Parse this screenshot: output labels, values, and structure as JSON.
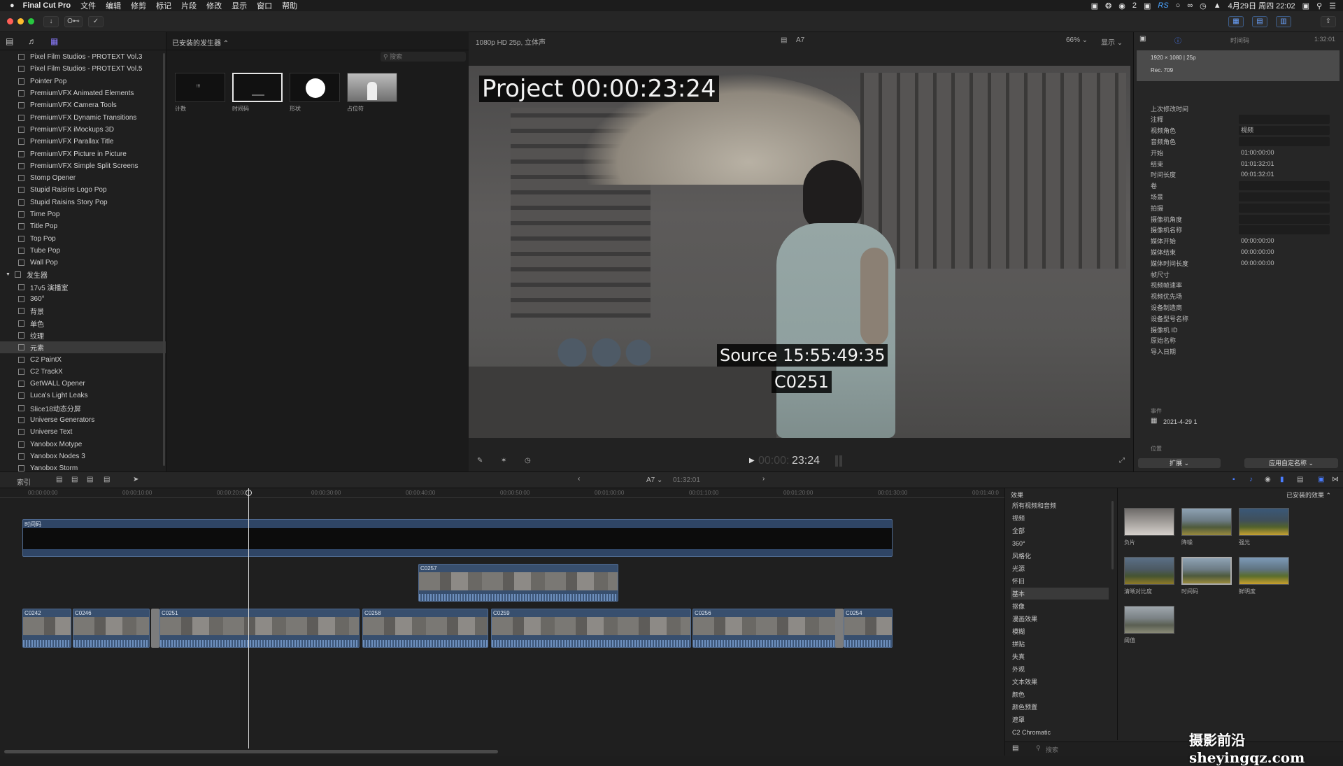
{
  "menubar": {
    "apple": "",
    "app": "Final Cut Pro",
    "items": [
      "文件",
      "编辑",
      "修剪",
      "标记",
      "片段",
      "修改",
      "显示",
      "窗口",
      "帮助"
    ],
    "status_wechat_count": "2",
    "status_letters": "RS",
    "clock": "4月29日 周四 22:02"
  },
  "toolbar": {
    "key_label": "O⊷"
  },
  "sidebar": {
    "items": [
      {
        "label": "Pixel Film Studios - PROTEXT Vol.3",
        "type": "item"
      },
      {
        "label": "Pixel Film Studios - PROTEXT Vol.5",
        "type": "item"
      },
      {
        "label": "Pointer Pop",
        "type": "item"
      },
      {
        "label": "PremiumVFX Animated Elements",
        "type": "item"
      },
      {
        "label": "PremiumVFX Camera Tools",
        "type": "item"
      },
      {
        "label": "PremiumVFX Dynamic Transitions",
        "type": "item"
      },
      {
        "label": "PremiumVFX iMockups 3D",
        "type": "item"
      },
      {
        "label": "PremiumVFX Parallax Title",
        "type": "item"
      },
      {
        "label": "PremiumVFX Picture in Picture",
        "type": "item"
      },
      {
        "label": "PremiumVFX Simple Split Screens",
        "type": "item"
      },
      {
        "label": "Stomp Opener",
        "type": "item"
      },
      {
        "label": "Stupid Raisins Logo Pop",
        "type": "item"
      },
      {
        "label": "Stupid Raisins Story Pop",
        "type": "item"
      },
      {
        "label": "Time Pop",
        "type": "item"
      },
      {
        "label": "Title Pop",
        "type": "item"
      },
      {
        "label": "Top Pop",
        "type": "item"
      },
      {
        "label": "Tube Pop",
        "type": "item"
      },
      {
        "label": "Wall Pop",
        "type": "item"
      },
      {
        "label": "发生器",
        "type": "group"
      },
      {
        "label": "17v5 演播室",
        "type": "item"
      },
      {
        "label": "360°",
        "type": "item"
      },
      {
        "label": "背景",
        "type": "item"
      },
      {
        "label": "单色",
        "type": "item"
      },
      {
        "label": "纹理",
        "type": "item"
      },
      {
        "label": "元素",
        "type": "selected"
      },
      {
        "label": "C2 PaintX",
        "type": "item"
      },
      {
        "label": "C2 TrackX",
        "type": "item"
      },
      {
        "label": "GetWALL Opener",
        "type": "item"
      },
      {
        "label": "Luca's Light Leaks",
        "type": "item"
      },
      {
        "label": "Slice18动态分屏",
        "type": "item"
      },
      {
        "label": "Universe Generators",
        "type": "item"
      },
      {
        "label": "Universe Text",
        "type": "item"
      },
      {
        "label": "Yanobox Motype",
        "type": "item"
      },
      {
        "label": "Yanobox Nodes 3",
        "type": "item"
      },
      {
        "label": "Yanobox Storm",
        "type": "item"
      }
    ]
  },
  "browser": {
    "title": "已安装的发生器 ⌃",
    "search_placeholder": "搜索",
    "thumbs": [
      {
        "label": "计数",
        "inner": "!!!"
      },
      {
        "label": "时间码",
        "inner": ""
      },
      {
        "label": "形状",
        "inner": ""
      },
      {
        "label": "占位符",
        "inner": ""
      }
    ]
  },
  "viewer": {
    "format": "1080p HD 25p, 立体声",
    "project": "A7",
    "zoom": "66% ⌄",
    "display": "显示 ⌄",
    "overlay_project": "Project 00:00:23:24",
    "overlay_source": "Source 15:55:49:35",
    "overlay_clip": "C0251",
    "timecode_dim": "00:00:",
    "timecode": "23:24"
  },
  "inspector": {
    "tab_label": "时间码",
    "duration": "1:32:01",
    "resolution": "1920 × 1080 | 25p",
    "colorspace": "Rec. 709",
    "rows": [
      {
        "label": "上次修改时间",
        "value": "",
        "field": false
      },
      {
        "label": "注释",
        "value": "",
        "field": true
      },
      {
        "label": "视频角色",
        "value": "视频",
        "field": true
      },
      {
        "label": "音频角色",
        "value": "",
        "field": true
      },
      {
        "label": "开始",
        "value": "01:00:00:00",
        "field": false
      },
      {
        "label": "结束",
        "value": "01:01:32:01",
        "field": false
      },
      {
        "label": "时间长度",
        "value": "00:01:32:01",
        "field": false
      },
      {
        "label": "卷",
        "value": "",
        "field": true
      },
      {
        "label": "场景",
        "value": "",
        "field": true
      },
      {
        "label": "拍摄",
        "value": "",
        "field": true
      },
      {
        "label": "摄像机角度",
        "value": "",
        "field": true
      },
      {
        "label": "摄像机名称",
        "value": "",
        "field": true
      },
      {
        "label": "媒体开始",
        "value": "00:00:00:00",
        "field": false
      },
      {
        "label": "媒体结束",
        "value": "00:00:00:00",
        "field": false
      },
      {
        "label": "媒体时间长度",
        "value": "00:00:00:00",
        "field": false
      },
      {
        "label": "帧尺寸",
        "value": "",
        "field": false
      },
      {
        "label": "视频帧速率",
        "value": "",
        "field": false
      },
      {
        "label": "视频优先场",
        "value": "",
        "field": false
      },
      {
        "label": "设备制造商",
        "value": "",
        "field": false
      },
      {
        "label": "设备型号名称",
        "value": "",
        "field": false
      },
      {
        "label": "摄像机 ID",
        "value": "",
        "field": false
      },
      {
        "label": "原始名称",
        "value": "",
        "field": false
      },
      {
        "label": "导入日期",
        "value": "",
        "field": false
      }
    ],
    "event_label": "事件",
    "event_value": "2021-4-29 1",
    "location_label": "位置",
    "expand_btn": "扩展 ⌄",
    "apply_btn": "应用自定名称 ⌄"
  },
  "timeline_head": {
    "index": "索引",
    "project": "A7 ⌄",
    "duration": "01:32:01"
  },
  "ruler": [
    "00:00:00:00",
    "00:00:10:00",
    "00:00:20:00",
    "00:00:30:00",
    "00:00:40:00",
    "00:00:50:00",
    "00:01:00:00",
    "00:01:10:00",
    "00:01:20:00",
    "00:01:30:00",
    "00:01:40:0"
  ],
  "clips": {
    "title_clip": "时间码",
    "connected": "C0257",
    "primary": [
      "C0242",
      "C0246",
      "C0251",
      "C0258",
      "C0259",
      "C0256",
      "C0254"
    ]
  },
  "effects": {
    "header": "效果",
    "installed": "已安装的效果 ⌃",
    "categories": [
      "所有视频和音频",
      "视频",
      "全部",
      "360°",
      "风格化",
      "光源",
      "怀旧",
      "基本",
      "抠像",
      "漫画效果",
      "模糊",
      "拼贴",
      "失真",
      "外观",
      "文本效果",
      "颜色",
      "颜色预置",
      "遮罩",
      "C2 Chromatic"
    ],
    "selected": "基本",
    "thumbs": [
      "负片",
      "降噪",
      "强光",
      "清晰对比度",
      "时间码",
      "鲜明度",
      "阈值"
    ],
    "search_placeholder": "搜索"
  },
  "watermark": "摄影前沿 sheyingqz.com"
}
